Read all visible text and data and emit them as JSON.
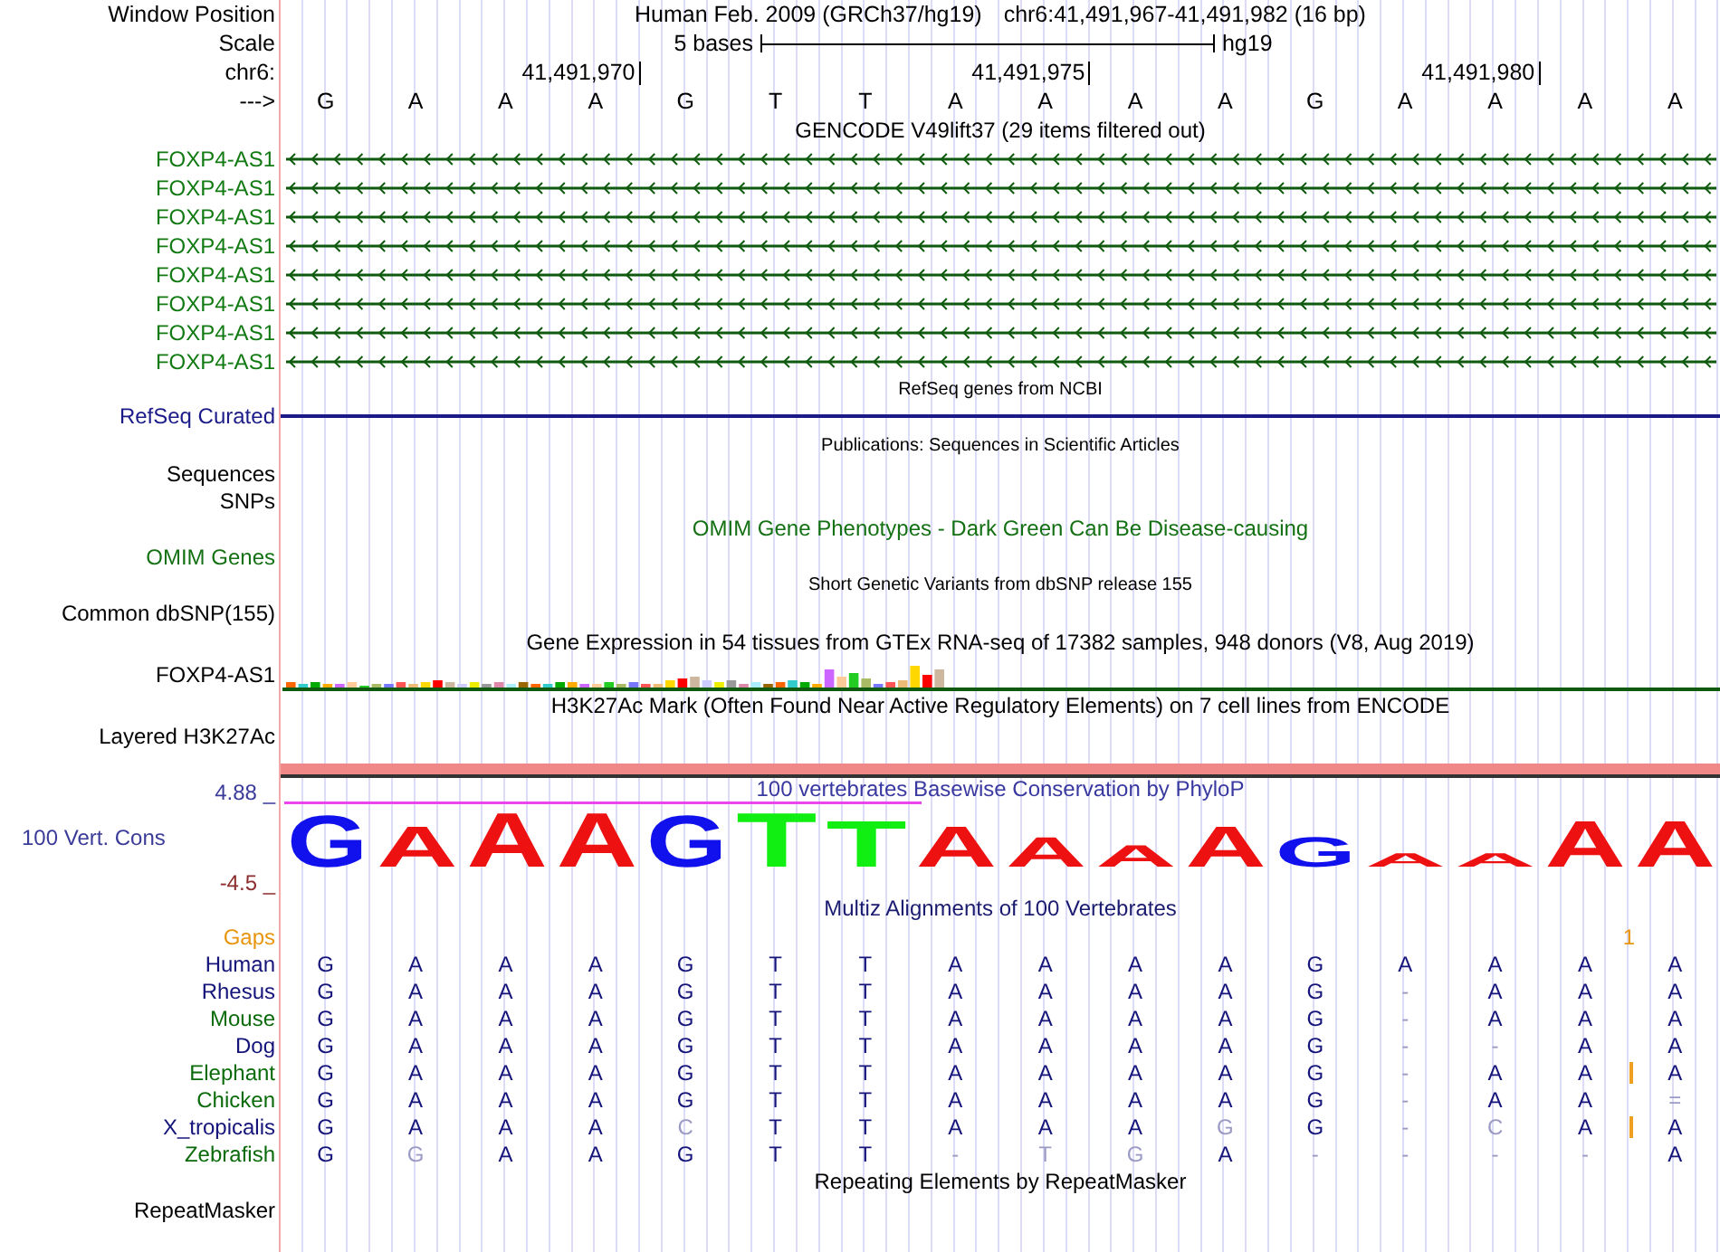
{
  "header": {
    "position_label": "Window Position",
    "assembly": "Human Feb. 2009 (GRCh37/hg19)",
    "position": "chr6:41,491,967-41,491,982 (16 bp)",
    "scale_label": "Scale",
    "scale_text": "5 bases",
    "scale_assembly": "hg19",
    "chrom_label": "chr6:",
    "strand_label": "--->",
    "bases": [
      {
        "base": "G"
      },
      {
        "base": "A"
      },
      {
        "base": "A"
      },
      {
        "base": "A",
        "tick": "41,491,970"
      },
      {
        "base": "G"
      },
      {
        "base": "T"
      },
      {
        "base": "T"
      },
      {
        "base": "A"
      },
      {
        "base": "A",
        "tick": "41,491,975"
      },
      {
        "base": "A"
      },
      {
        "base": "A"
      },
      {
        "base": "G"
      },
      {
        "base": "A"
      },
      {
        "base": "A",
        "tick": "41,491,980"
      },
      {
        "base": "A"
      },
      {
        "base": "A"
      }
    ]
  },
  "tracks": [
    {
      "kind": "gene",
      "title": "GENCODE V49lift37 (29 items filtered out)",
      "color": "#127a12",
      "items": [
        {
          "label": "FOXP4-AS1"
        },
        {
          "label": "FOXP4-AS1"
        },
        {
          "label": "FOXP4-AS1"
        },
        {
          "label": "FOXP4-AS1"
        },
        {
          "label": "FOXP4-AS1"
        },
        {
          "label": "FOXP4-AS1"
        },
        {
          "label": "FOXP4-AS1"
        },
        {
          "label": "FOXP4-AS1"
        }
      ]
    },
    {
      "kind": "line",
      "title": "RefSeq genes from NCBI",
      "label": "RefSeq Curated",
      "color": "#1a1a88"
    },
    {
      "kind": "empty",
      "title": "Publications: Sequences in Scientific Articles"
    },
    {
      "kind": "empty",
      "label": "Sequences"
    },
    {
      "kind": "empty",
      "label": "SNPs"
    },
    {
      "kind": "phenotype",
      "title": "OMIM Gene Phenotypes - Dark Green Can Be Disease-causing",
      "label": "OMIM Genes",
      "color": "#137013"
    },
    {
      "kind": "empty",
      "title": "Short Genetic Variants from dbSNP release 155",
      "label": "Common dbSNP(155)"
    },
    {
      "kind": "expression",
      "title": "Gene Expression in 54 tissues from GTEx RNA-seq of 17382 samples, 948 donors (V8, Aug 2019)",
      "label": "FOXP4-AS1"
    },
    {
      "kind": "signal",
      "title": "H3K27Ac Mark (Often Found Near Active Regulatory Elements) on 7 cell lines from ENCODE",
      "label": "Layered H3K27Ac"
    },
    {
      "kind": "conservation",
      "title": "100 vertebrates Basewise Conservation by PhyloP",
      "label": "100 Vert. Cons",
      "max": "4.88 _",
      "min": "-4.5 _",
      "logo": [
        {
          "base": "G"
        },
        {
          "base": "A"
        },
        {
          "base": "A"
        },
        {
          "base": "A"
        },
        {
          "base": "G"
        },
        {
          "base": "T"
        },
        {
          "base": "T"
        },
        {
          "base": "A"
        },
        {
          "base": "A"
        },
        {
          "base": "A"
        },
        {
          "base": "A"
        },
        {
          "base": "G"
        },
        {
          "base": "A"
        },
        {
          "base": "A"
        },
        {
          "base": "A"
        },
        {
          "base": "A"
        }
      ]
    },
    {
      "kind": "alignment",
      "title": "Multiz Alignments of 100 Vertebrates",
      "gaps": {
        "label": "Gaps",
        "count": "1"
      },
      "species": [
        {
          "name": "Human",
          "color": "#14147a",
          "insertion": false,
          "bases": [
            "G",
            "A",
            "A",
            "A",
            "G",
            "T",
            "T",
            "A",
            "A",
            "A",
            "A",
            "G",
            "A",
            "A",
            "A",
            "A"
          ]
        },
        {
          "name": "Rhesus",
          "color": "#14147a",
          "insertion": false,
          "bases": [
            "G",
            "A",
            "A",
            "A",
            "G",
            "T",
            "T",
            "A",
            "A",
            "A",
            "A",
            "G",
            "-",
            "A",
            "A",
            "A"
          ]
        },
        {
          "name": "Mouse",
          "color": "#0b6b0b",
          "insertion": false,
          "bases": [
            "G",
            "A",
            "A",
            "A",
            "G",
            "T",
            "T",
            "A",
            "A",
            "A",
            "A",
            "G",
            "-",
            "A",
            "A",
            "A"
          ]
        },
        {
          "name": "Dog",
          "color": "#14147a",
          "insertion": false,
          "bases": [
            "G",
            "A",
            "A",
            "A",
            "G",
            "T",
            "T",
            "A",
            "A",
            "A",
            "A",
            "G",
            "-",
            "-",
            "A",
            "A"
          ]
        },
        {
          "name": "Elephant",
          "color": "#0b6b0b",
          "insertion": true,
          "bases": [
            "G",
            "A",
            "A",
            "A",
            "G",
            "T",
            "T",
            "A",
            "A",
            "A",
            "A",
            "G",
            "-",
            "A",
            "A",
            "A"
          ]
        },
        {
          "name": "Chicken",
          "color": "#0b6b0b",
          "insertion": false,
          "bases": [
            "G",
            "A",
            "A",
            "A",
            "G",
            "T",
            "T",
            "A",
            "A",
            "A",
            "A",
            "G",
            "-",
            "A",
            "A",
            "="
          ]
        },
        {
          "name": "X_tropicalis",
          "color": "#14147a",
          "insertion": true,
          "bases": [
            "G",
            "A",
            "A",
            "A",
            "C",
            "T",
            "T",
            "A",
            "A",
            "A",
            "G",
            "G",
            "-",
            "C",
            "A",
            "A"
          ]
        },
        {
          "name": "Zebrafish",
          "color": "#0b6b0b",
          "insertion": false,
          "bases": [
            "G",
            "G",
            "A",
            "A",
            "G",
            "T",
            "T",
            "-",
            "T",
            "G",
            "A",
            "-",
            "-",
            "-",
            "-",
            "A"
          ]
        }
      ]
    },
    {
      "kind": "repeat",
      "title": "Repeating Elements by RepeatMasker",
      "label": "RepeatMasker"
    }
  ]
}
